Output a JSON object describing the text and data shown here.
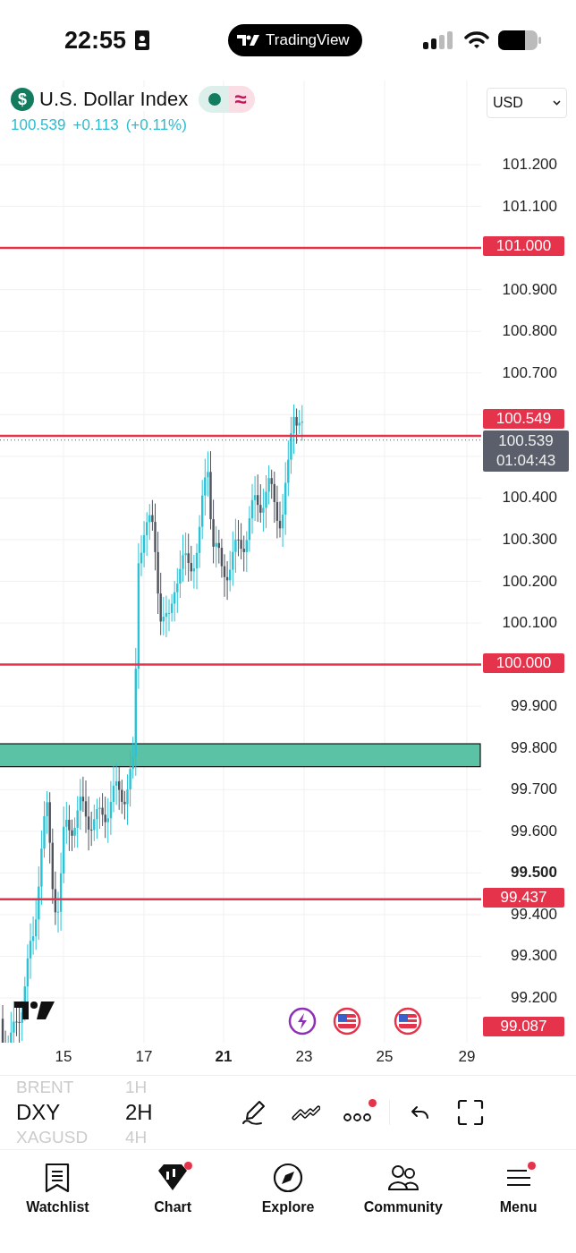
{
  "status_bar": {
    "time": "22:55",
    "app_pill": "TradingView"
  },
  "symbol": {
    "icon_glyph": "$",
    "name": "U.S. Dollar Index",
    "badge": "≈",
    "price": "100.539",
    "change": "+0.113",
    "change_pct": "(+0.11%)"
  },
  "currency_select": {
    "value": "USD"
  },
  "price_axis": [
    {
      "text": "101.200",
      "bold": false
    },
    {
      "text": "101.100",
      "bold": false
    },
    {
      "text": "100.900",
      "bold": false
    },
    {
      "text": "100.800",
      "bold": false
    },
    {
      "text": "100.700",
      "bold": false
    },
    {
      "text": "100.400",
      "bold": false
    },
    {
      "text": "100.300",
      "bold": false
    },
    {
      "text": "100.200",
      "bold": false
    },
    {
      "text": "100.100",
      "bold": false
    },
    {
      "text": "99.900",
      "bold": false
    },
    {
      "text": "99.800",
      "bold": false
    },
    {
      "text": "99.700",
      "bold": false
    },
    {
      "text": "99.600",
      "bold": false
    },
    {
      "text": "99.500",
      "bold": true
    },
    {
      "text": "99.400",
      "bold": false
    },
    {
      "text": "99.300",
      "bold": false
    },
    {
      "text": "99.200",
      "bold": false
    }
  ],
  "levels": [
    {
      "label": "101.000"
    },
    {
      "label": "100.549"
    },
    {
      "label": "100.000"
    },
    {
      "label": "99.437"
    },
    {
      "label": "99.087"
    }
  ],
  "current_price": {
    "price": "100.539",
    "countdown": "01:04:43"
  },
  "time_axis": [
    {
      "text": "15",
      "bold": false
    },
    {
      "text": "17",
      "bold": false
    },
    {
      "text": "21",
      "bold": true
    },
    {
      "text": "23",
      "bold": false
    },
    {
      "text": "25",
      "bold": false
    },
    {
      "text": "29",
      "bold": false
    }
  ],
  "events": [
    {
      "kind": "lightning"
    },
    {
      "kind": "flag"
    },
    {
      "kind": "flag"
    }
  ],
  "symbols": [
    {
      "label": "BRENT",
      "selected": false
    },
    {
      "label": "DXY",
      "selected": true
    },
    {
      "label": "XAGUSD",
      "selected": false
    }
  ],
  "intervals": [
    {
      "label": "1H",
      "selected": false
    },
    {
      "label": "2H",
      "selected": true
    },
    {
      "label": "4H",
      "selected": false
    }
  ],
  "toolbar": [
    {
      "kind": "pen",
      "dot": false
    },
    {
      "kind": "pattern",
      "dot": false
    },
    {
      "kind": "more",
      "dot": true
    },
    {
      "kind": "undo",
      "dot": false
    },
    {
      "kind": "fullscreen",
      "dot": false
    }
  ],
  "nav": [
    {
      "label": "Watchlist",
      "kind": "watchlist",
      "dot": false
    },
    {
      "label": "Chart",
      "kind": "chart",
      "dot": true
    },
    {
      "label": "Explore",
      "kind": "explore",
      "dot": false
    },
    {
      "label": "Community",
      "kind": "community",
      "dot": false
    },
    {
      "label": "Menu",
      "kind": "menu",
      "dot": true
    }
  ]
}
